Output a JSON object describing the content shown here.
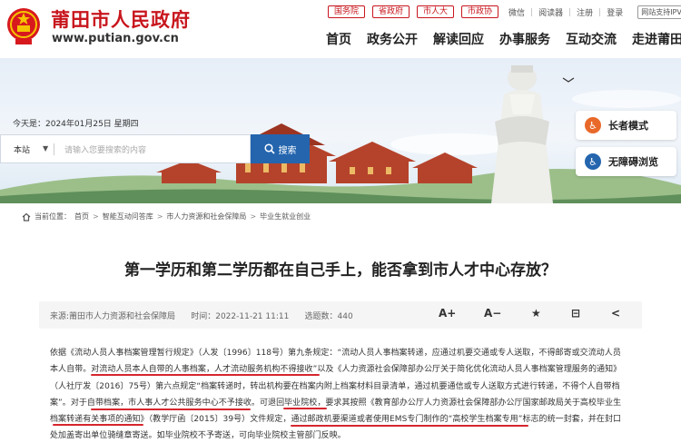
{
  "header": {
    "site_name": "莆田市人民政府",
    "site_url": "www.putian.gov.cn",
    "gov_links": [
      "国务院",
      "省政府",
      "市人大",
      "市政协"
    ],
    "util_links": [
      "微信",
      "阅读器",
      "注册",
      "登录"
    ],
    "ipv6_badge": "网站支持IPV6",
    "nav": [
      "首页",
      "政务公开",
      "解读回应",
      "办事服务",
      "互动交流",
      "走进莆田"
    ]
  },
  "banner": {
    "date": "今天是：2024年01月25日 星期四",
    "site_select": "本站",
    "search_placeholder": "请输入您要搜索的内容",
    "search_button": "搜索",
    "elder_mode": "长者模式",
    "accessible": "无障碍浏览"
  },
  "breadcrumb": {
    "label": "当前位置：",
    "items": [
      "首页",
      "智能互动问答库",
      "市人力资源和社会保障局",
      "毕业生就业创业"
    ]
  },
  "article": {
    "title": "第一学历和第二学历都在自己手上，能否拿到市人才中心存放？",
    "source": "来源:莆田市人力资源和社会保障局",
    "time": "时间：2022-11-21 11:11",
    "views": "选题数：440",
    "tools": [
      "A+",
      "A−",
      "★",
      "⊟",
      "<"
    ],
    "lines": [
      "依据《流动人员人事档案管理暂行规定》（人发〔1996〕118号）第九条规定：“流动人员人事档案转递，应通过机要交通或专人送取，不得邮寄或交流动人员",
      "本人自带。对流动人员本人自带的人事档案，人才流动服务机构不得接收”以及《人力资源社会保障部办公厅关于简化优化流动人员人事档案管理服务的通知》",
      "（人社厅发〔2016〕75号）第六点规定“档案转递时，转出机构要在档案内附上档案材料目录清单，通过机要通信或专人送取方式进行转递，不得个人自带档",
      "案”。对于自带档案，市人事人才公共服务中心不予接收。可退回毕业院校，要求其按照《教育部办公厅人力资源社会保障部办公厅国家邮政局关于高校毕业生",
      "档案转递有关事项的通知》（教学厅函〔2015〕39号）文件规定，通过邮政机要渠道或者使用EMS专门制作的“高校学生档案专用”标志的统一封套，并在封口",
      "处加盖寄出单位骑缝章寄送。如毕业院校不予寄送，可向毕业院校主管部门反映。"
    ]
  },
  "colors": {
    "brand_red": "#c8161d",
    "search_blue": "#2465ae",
    "underline_red": "#d6262e"
  }
}
